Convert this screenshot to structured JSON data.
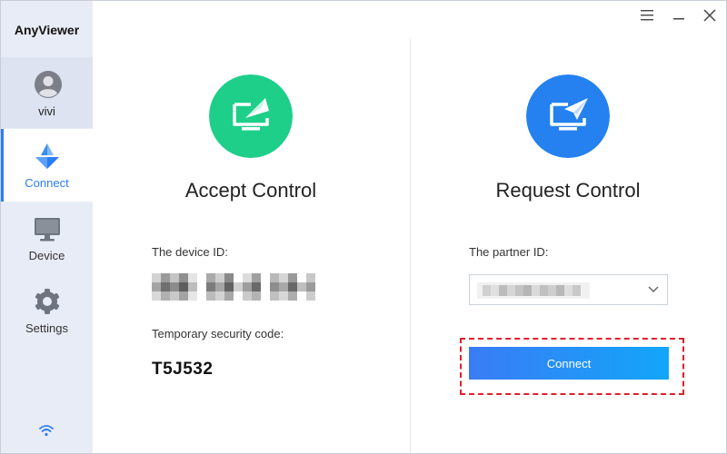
{
  "app": {
    "title": "AnyViewer"
  },
  "sidebar": {
    "user": {
      "name": "vivi",
      "avatar_icon": "user-avatar-icon"
    },
    "items": [
      {
        "label": "Connect",
        "icon": "connect-icon",
        "active": true
      },
      {
        "label": "Device",
        "icon": "monitor-icon",
        "active": false
      },
      {
        "label": "Settings",
        "icon": "gear-icon",
        "active": false
      }
    ],
    "status_icon": "wifi-icon"
  },
  "window_controls": {
    "menu_icon": "menu-icon",
    "minimize_icon": "minimize-icon",
    "close_icon": "close-icon"
  },
  "accept_panel": {
    "title": "Accept Control",
    "icon": "accept-control-icon",
    "device_id_label": "The device ID:",
    "device_id_value": "",
    "security_code_label": "Temporary security code:",
    "security_code_value": "T5J532"
  },
  "request_panel": {
    "title": "Request Control",
    "icon": "request-control-icon",
    "partner_id_label": "The partner ID:",
    "partner_id_value": "",
    "connect_button_label": "Connect"
  },
  "colors": {
    "accent": "#2b7df4",
    "accept_icon_bg": "#1ecf8a",
    "request_icon_bg": "#2481ef",
    "sidebar_bg": "#e8ecf6",
    "highlight": "#e0202a"
  }
}
